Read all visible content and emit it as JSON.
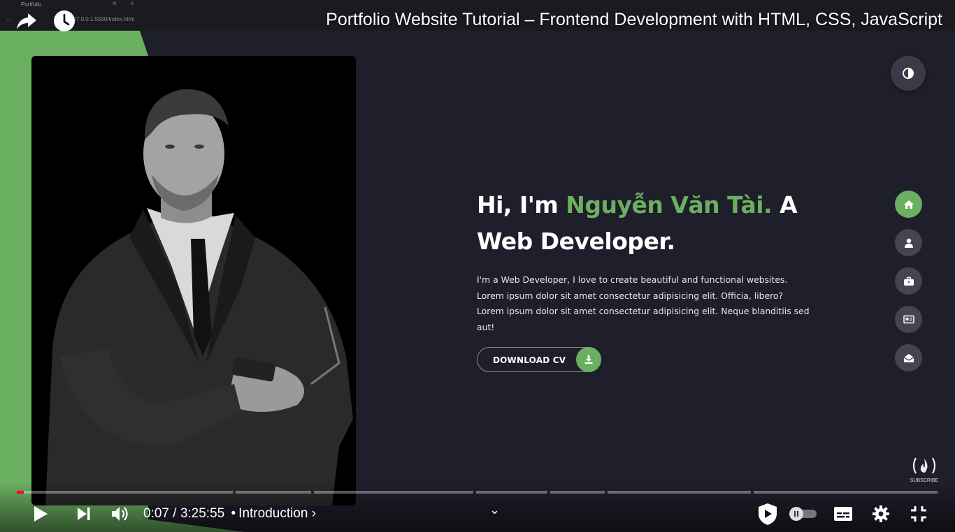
{
  "browser": {
    "tab_title": "Portfolio",
    "address": "127.0.0.1:5500/index.html"
  },
  "video": {
    "title": "Portfolio Website Tutorial – Frontend Development with HTML, CSS, JavaScript",
    "current_time": "0:07",
    "duration": "3:25:55",
    "separator": "/",
    "chapter": "Introduction",
    "progress_fraction": 0.0006,
    "accent_color": "#ff0033"
  },
  "hero": {
    "greeting": "Hi, I'm ",
    "name": "Nguyễn Văn Tài.",
    "role_prefix": " A",
    "role": "Web Developer.",
    "desc_line1": "I'm a Web Developer, I love to create beautiful and functional websites.",
    "desc_line2": "Lorem ipsum dolor sit amet consectetur adipisicing elit. Officia, libero?",
    "desc_line3": "Lorem ipsum dolor sit amet consectetur adipisicing elit. Neque blanditiis sed",
    "desc_line4": "aut!",
    "cv_label": "DOWNLOAD CV",
    "accent_color": "#6ab060"
  },
  "nav": {
    "items": [
      {
        "icon": "home-icon",
        "active": true
      },
      {
        "icon": "user-icon",
        "active": false
      },
      {
        "icon": "briefcase-icon",
        "active": false
      },
      {
        "icon": "portfolio-icon",
        "active": false
      },
      {
        "icon": "envelope-icon",
        "active": false
      }
    ]
  },
  "overlay": {
    "subscribe_label": "SUBSCRIBE"
  }
}
